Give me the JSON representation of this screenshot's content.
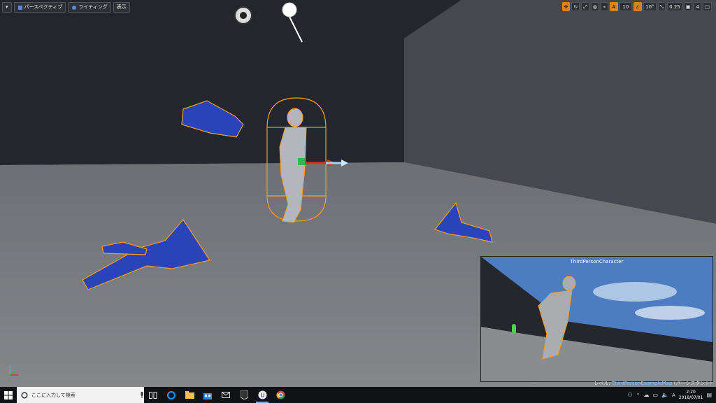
{
  "viewport_toolbar": {
    "menu_label": "▾",
    "perspective_label": "パースペクティブ",
    "lighting_label": "ライティング",
    "show_label": "表示"
  },
  "transform_toolbar": {
    "grid_snap_value": "10",
    "rotation_snap_value": "10°",
    "scale_snap_value": "0.25",
    "camera_speed_value": "4"
  },
  "preview": {
    "title": "ThirdPersonCharacter"
  },
  "level_status": {
    "prefix": "レベル: ",
    "map_name": "ThirdPersonExampleMap",
    "suffix": " (パーシスタント)"
  },
  "taskbar": {
    "search_placeholder": "ここに入力して検索",
    "clock_time": "2:20",
    "clock_date": "2018/07/01"
  },
  "colors": {
    "selection_orange": "#f5a11c",
    "prop_blue": "#2a43b8",
    "accent_blue": "#7fbfff"
  }
}
